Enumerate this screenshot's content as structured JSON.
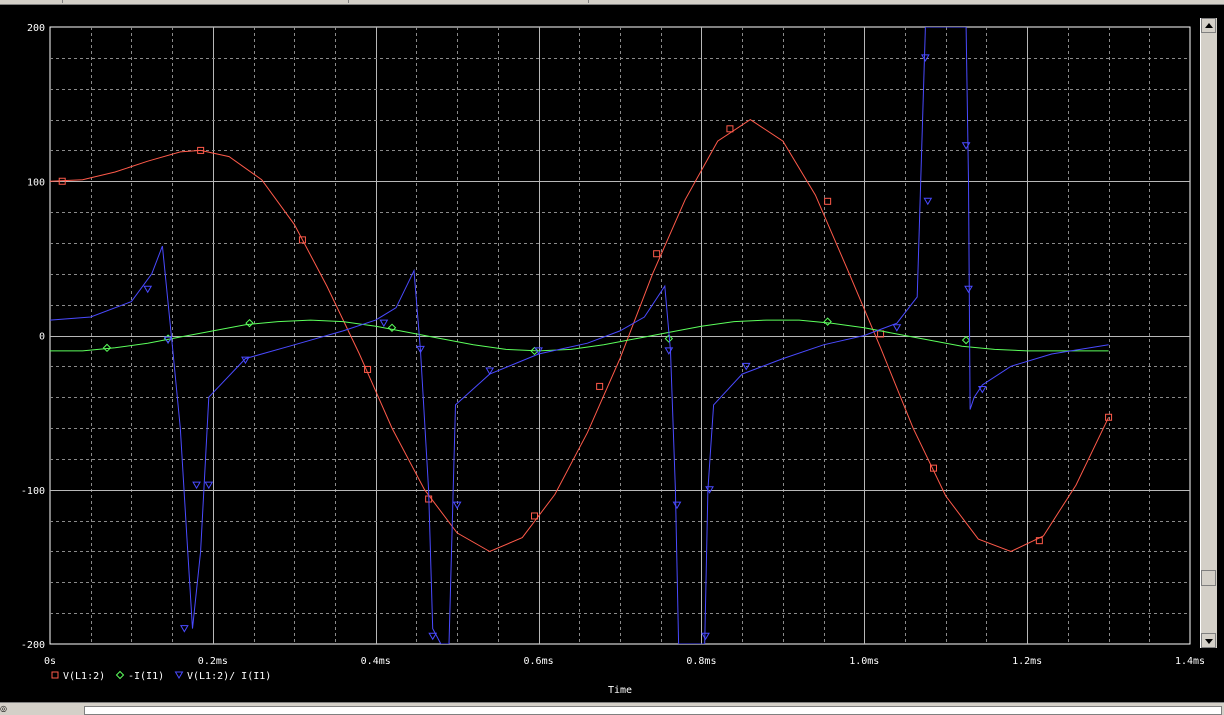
{
  "chart_data": {
    "type": "line",
    "xlabel": "Time",
    "ylabel": "",
    "title": "",
    "xlim": [
      0,
      1.4
    ],
    "ylim": [
      -200,
      200
    ],
    "x_unit": "ms",
    "x_ticks": [
      0,
      0.2,
      0.4,
      0.6,
      0.8,
      1.0,
      1.2,
      1.4
    ],
    "x_tick_labels": [
      "0s",
      "0.2ms",
      "0.4ms",
      "0.6ms",
      "0.8ms",
      "1.0ms",
      "1.2ms",
      "1.4ms"
    ],
    "y_ticks": [
      -200,
      -100,
      0,
      100,
      200
    ],
    "y_tick_labels": [
      "-200",
      "-100",
      "0",
      "100",
      "200"
    ],
    "grid": true,
    "legend_position": "bottom-left",
    "series": [
      {
        "name": "V(L1:2)",
        "color": "#ff5a4a",
        "marker": "square",
        "x": [
          0.0,
          0.04,
          0.08,
          0.12,
          0.16,
          0.185,
          0.22,
          0.26,
          0.3,
          0.34,
          0.38,
          0.42,
          0.46,
          0.5,
          0.54,
          0.58,
          0.62,
          0.66,
          0.7,
          0.74,
          0.78,
          0.82,
          0.86,
          0.9,
          0.94,
          0.98,
          1.02,
          1.06,
          1.1,
          1.14,
          1.18,
          1.22,
          1.26,
          1.3
        ],
        "y": [
          100,
          101,
          106,
          113,
          119,
          120,
          116,
          101,
          72,
          32,
          -12,
          -60,
          -100,
          -128,
          -140,
          -131,
          -103,
          -63,
          -15,
          40,
          88,
          126,
          140,
          126,
          91,
          42,
          -8,
          -60,
          -104,
          -132,
          -140,
          -130,
          -97,
          -53
        ],
        "marker_x": [
          0.015,
          0.185,
          0.31,
          0.39,
          0.465,
          0.595,
          0.675,
          0.745,
          0.835,
          0.955,
          1.02,
          1.085,
          1.215,
          1.3
        ],
        "marker_y": [
          100,
          120,
          62,
          -22,
          -106,
          -117,
          -33,
          53,
          134,
          87,
          1,
          -86,
          -133,
          -53
        ]
      },
      {
        "name": "-I(I1)",
        "color": "#5cff5c",
        "marker": "diamond",
        "x": [
          0.0,
          0.04,
          0.08,
          0.12,
          0.16,
          0.2,
          0.24,
          0.28,
          0.32,
          0.36,
          0.4,
          0.44,
          0.48,
          0.52,
          0.56,
          0.6,
          0.64,
          0.68,
          0.72,
          0.76,
          0.8,
          0.84,
          0.88,
          0.92,
          0.96,
          1.0,
          1.04,
          1.08,
          1.12,
          1.16,
          1.2,
          1.24,
          1.28,
          1.3
        ],
        "y": [
          -10,
          -10,
          -8,
          -5,
          -1,
          3,
          7,
          9,
          10,
          9,
          6,
          2,
          -2,
          -6,
          -9,
          -10,
          -9,
          -6,
          -2,
          2,
          6,
          9,
          10,
          10,
          8,
          5,
          1,
          -3,
          -7,
          -9,
          -10,
          -10,
          -10,
          -10
        ],
        "marker_x": [
          0.07,
          0.145,
          0.245,
          0.42,
          0.595,
          0.76,
          0.955,
          1.125
        ],
        "marker_y": [
          -8,
          -2,
          8,
          5,
          -10,
          -2,
          9,
          -3
        ]
      },
      {
        "name": "V(L1:2)/ I(I1)",
        "color": "#4a4aff",
        "marker": "triangle-down",
        "x": [
          0.0,
          0.05,
          0.1,
          0.125,
          0.138,
          0.15,
          0.16,
          0.168,
          0.175,
          0.185,
          0.195,
          0.24,
          0.3,
          0.36,
          0.4,
          0.425,
          0.447,
          0.455,
          0.465,
          0.47,
          0.48,
          0.49,
          0.498,
          0.54,
          0.6,
          0.66,
          0.7,
          0.73,
          0.755,
          0.762,
          0.768,
          0.772,
          0.776,
          0.8,
          0.804,
          0.808,
          0.815,
          0.85,
          0.9,
          0.95,
          1.0,
          1.04,
          1.065,
          1.075,
          1.078,
          1.082,
          1.09,
          1.1,
          1.11,
          1.12,
          1.125,
          1.128,
          1.13,
          1.135,
          1.145,
          1.18,
          1.23,
          1.3
        ],
        "y": [
          10,
          12,
          22,
          40,
          58,
          -5,
          -60,
          -130,
          -190,
          -140,
          -40,
          -15,
          -6,
          3,
          10,
          18,
          42,
          -10,
          -100,
          -190,
          -200,
          -200,
          -45,
          -25,
          -12,
          -5,
          3,
          12,
          32,
          -10,
          -100,
          -200,
          -200,
          -200,
          -200,
          -100,
          -45,
          -25,
          -15,
          -6,
          0,
          8,
          25,
          200,
          200,
          200,
          200,
          200,
          200,
          200,
          200,
          100,
          -48,
          -40,
          -32,
          -20,
          -12,
          -6
        ],
        "marker_x": [
          0.12,
          0.145,
          0.165,
          0.18,
          0.195,
          0.24,
          0.41,
          0.455,
          0.47,
          0.5,
          0.54,
          0.6,
          0.76,
          0.77,
          0.805,
          0.81,
          0.855,
          1.04,
          1.075,
          1.078,
          1.125,
          1.128,
          1.145
        ],
        "marker_y": [
          30,
          -3,
          -190,
          -97,
          -97,
          -16,
          8,
          -9,
          -195,
          -110,
          -23,
          -10,
          -10,
          -110,
          -195,
          -100,
          -20,
          5,
          180,
          87,
          123,
          30,
          -35
        ]
      }
    ]
  }
}
